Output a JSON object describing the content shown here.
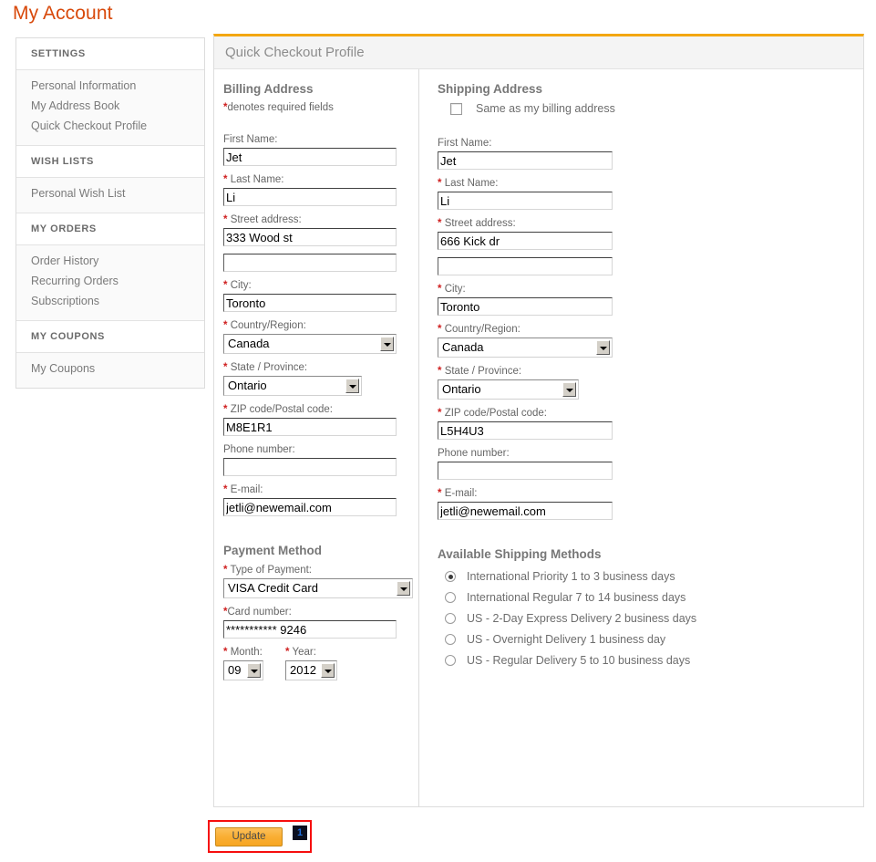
{
  "page": {
    "title": "My Account"
  },
  "sidebar": {
    "groups": [
      {
        "heading": "SETTINGS",
        "links": [
          "Personal Information",
          "My Address Book",
          "Quick Checkout Profile"
        ]
      },
      {
        "heading": "WISH LISTS",
        "links": [
          "Personal Wish List"
        ]
      },
      {
        "heading": "MY ORDERS",
        "links": [
          "Order History",
          "Recurring Orders",
          "Subscriptions"
        ]
      },
      {
        "heading": "MY COUPONS",
        "links": [
          "My Coupons"
        ]
      }
    ]
  },
  "panel": {
    "heading": "Quick Checkout Profile"
  },
  "billing": {
    "section_title": "Billing Address",
    "required_note": "denotes required fields",
    "required_star": "*",
    "labels": {
      "first_name": "First Name:",
      "last_name": "Last Name:",
      "street": "Street address:",
      "street2": "",
      "city": "City:",
      "country": "Country/Region:",
      "state": "State / Province:",
      "zip": "ZIP code/Postal code:",
      "phone": "Phone number:",
      "email": "E-mail:"
    },
    "values": {
      "first_name": "Jet",
      "last_name": "Li",
      "street": "333 Wood st",
      "street2": "",
      "city": "Toronto",
      "country": "Canada",
      "state": "Ontario",
      "zip": "M8E1R1",
      "phone": "",
      "email": "jetli@newemail.com"
    }
  },
  "shipping": {
    "section_title": "Shipping Address",
    "same_as_billing_label": "Same as my billing address",
    "same_as_billing_checked": false,
    "labels": {
      "first_name": "First Name:",
      "last_name": "Last Name:",
      "street": "Street address:",
      "street2": "",
      "city": "City:",
      "country": "Country/Region:",
      "state": "State / Province:",
      "zip": "ZIP code/Postal code:",
      "phone": "Phone number:",
      "email": "E-mail:"
    },
    "values": {
      "first_name": "Jet",
      "last_name": "Li",
      "street": "666 Kick dr",
      "street2": "",
      "city": "Toronto",
      "country": "Canada",
      "state": "Ontario",
      "zip": "L5H4U3",
      "phone": "",
      "email": "jetli@newemail.com"
    }
  },
  "payment": {
    "section_title": "Payment Method",
    "labels": {
      "type": "Type of Payment:",
      "card_number": "Card number:",
      "month": "Month:",
      "year": "Year:"
    },
    "values": {
      "type": "VISA Credit Card",
      "card_number": "*********** 9246",
      "month": "09",
      "year": "2012"
    }
  },
  "shipping_methods": {
    "section_title": "Available Shipping Methods",
    "options": [
      {
        "label": "International Priority 1 to 3 business days",
        "selected": true
      },
      {
        "label": "International Regular 7 to 14 business days",
        "selected": false
      },
      {
        "label": "US - 2-Day Express Delivery 2 business days",
        "selected": false
      },
      {
        "label": "US - Overnight Delivery 1 business day",
        "selected": false
      },
      {
        "label": "US - Regular Delivery 5 to 10 business days",
        "selected": false
      }
    ]
  },
  "footer": {
    "update_label": "Update",
    "step_badge": "1"
  },
  "colors": {
    "brand_orange": "#d8490b",
    "panel_top_border": "#f3a712",
    "required_star": "#cf2020",
    "annotation_red": "#f60e0e",
    "badge_bg": "#0b0f1e",
    "badge_text": "#1f6fe0"
  }
}
